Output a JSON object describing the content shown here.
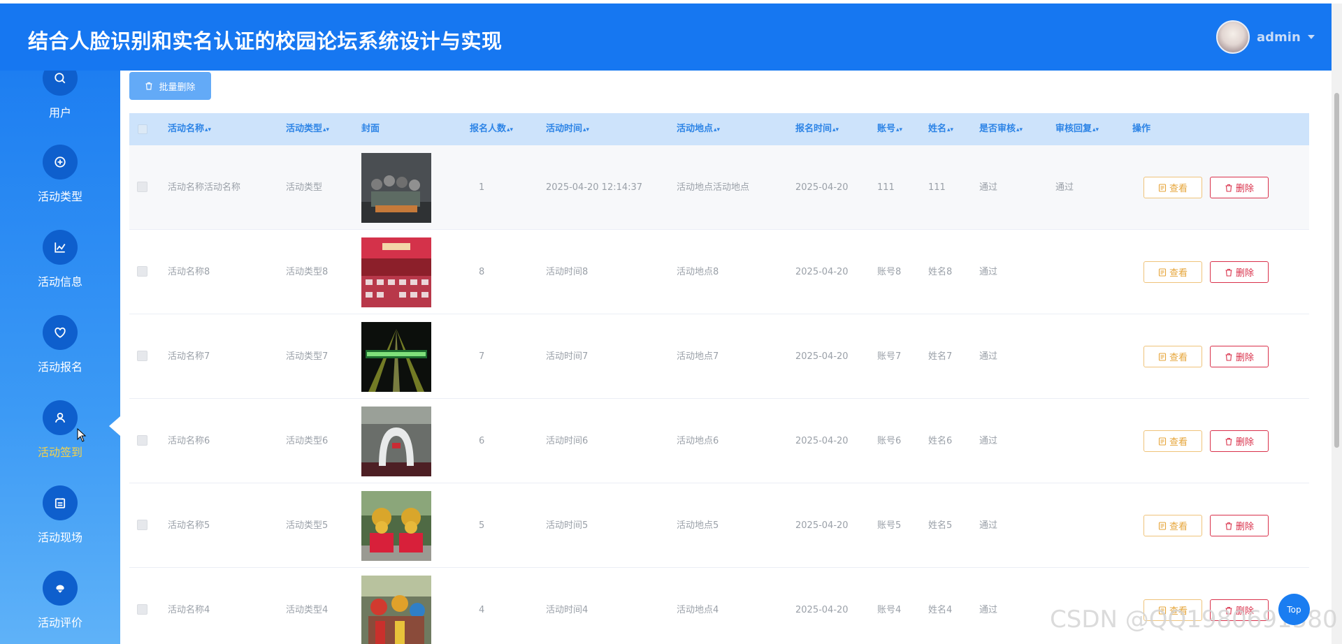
{
  "header": {
    "title": "结合人脸识别和实名认证的校园论坛系统设计与实现",
    "user": "admin"
  },
  "sidebar": {
    "items": [
      {
        "label": "用户",
        "icon": "search-icon"
      },
      {
        "label": "活动类型",
        "icon": "plus-circle-icon"
      },
      {
        "label": "活动信息",
        "icon": "line-chart-icon"
      },
      {
        "label": "活动报名",
        "icon": "heart-icon"
      },
      {
        "label": "活动签到",
        "icon": "user-icon",
        "active": true
      },
      {
        "label": "活动现场",
        "icon": "calendar-icon"
      },
      {
        "label": "活动评价",
        "icon": "ice-cream-icon"
      }
    ]
  },
  "toolbar": {
    "bulk_delete": "批量删除"
  },
  "table": {
    "columns": [
      "活动名称",
      "活动类型",
      "封面",
      "报名人数",
      "活动时间",
      "活动地点",
      "报名时间",
      "账号",
      "姓名",
      "是否审核",
      "审核回复",
      "操作"
    ],
    "rows": [
      {
        "name": "活动名称活动名称",
        "type": "活动类型",
        "count": "1",
        "time": "2025-04-20 12:14:37",
        "place": "活动地点活动地点",
        "signup": "2025-04-20",
        "account": "111",
        "person": "111",
        "audited": "通过",
        "reply": "通过"
      },
      {
        "name": "活动名称8",
        "type": "活动类型8",
        "count": "8",
        "time": "活动时间8",
        "place": "活动地点8",
        "signup": "2025-04-20",
        "account": "账号8",
        "person": "姓名8",
        "audited": "通过",
        "reply": ""
      },
      {
        "name": "活动名称7",
        "type": "活动类型7",
        "count": "7",
        "time": "活动时间7",
        "place": "活动地点7",
        "signup": "2025-04-20",
        "account": "账号7",
        "person": "姓名7",
        "audited": "通过",
        "reply": ""
      },
      {
        "name": "活动名称6",
        "type": "活动类型6",
        "count": "6",
        "time": "活动时间6",
        "place": "活动地点6",
        "signup": "2025-04-20",
        "account": "账号6",
        "person": "姓名6",
        "audited": "通过",
        "reply": ""
      },
      {
        "name": "活动名称5",
        "type": "活动类型5",
        "count": "5",
        "time": "活动时间5",
        "place": "活动地点5",
        "signup": "2025-04-20",
        "account": "账号5",
        "person": "姓名5",
        "audited": "通过",
        "reply": ""
      },
      {
        "name": "活动名称4",
        "type": "活动类型4",
        "count": "4",
        "time": "活动时间4",
        "place": "活动地点4",
        "signup": "2025-04-20",
        "account": "账号4",
        "person": "姓名4",
        "audited": "通过",
        "reply": ""
      }
    ],
    "view_label": "查看",
    "delete_label": "删除"
  },
  "top_button": "Top",
  "watermark": "CSDN @QQ1980691580",
  "colors": {
    "header": "#1677f1",
    "active_nav": "#f5d24a",
    "view": "#e6a53a",
    "delete": "#d9304a"
  }
}
